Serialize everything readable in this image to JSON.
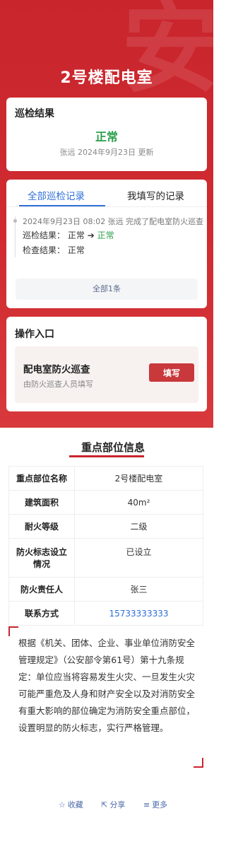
{
  "header": {
    "title": "2号楼配电室"
  },
  "inspection_result": {
    "heading": "巡检结果",
    "status": "正常",
    "meta": "张远 2024年9月23日 更新"
  },
  "records": {
    "tabs": [
      {
        "label": "全部巡检记录"
      },
      {
        "label": "我填写的记录"
      }
    ],
    "items": [
      {
        "header": "2024年9月23日 08:02  张远  完成了配电室防火巡查",
        "line1_label": "巡检结果：",
        "line1_from": "正常",
        "line1_arrow": "➔",
        "line1_to": "正常",
        "line2_label": "检查结果：",
        "line2_value": "正常"
      }
    ],
    "more_label": "全部1条"
  },
  "operations": {
    "heading": "操作入口",
    "item_title": "配电室防火巡查",
    "item_desc": "由防火巡查人员填写",
    "button_label": "填写"
  },
  "key_info": {
    "heading": "重点部位信息",
    "rows": [
      {
        "key": "重点部位名称",
        "value": "2号楼配电室"
      },
      {
        "key": "建筑面积",
        "value": "40m²"
      },
      {
        "key": "耐火等级",
        "value": "二级"
      },
      {
        "key": "防火标志设立情况",
        "value": "已设立"
      },
      {
        "key": "防火责任人",
        "value": "张三"
      },
      {
        "key": "联系方式",
        "value": "15733333333"
      }
    ]
  },
  "regulation_text": "根据《机关、团体、企业、事业单位消防安全管理规定》（公安部令第61号）第十九条规定：单位应当将容易发生火灾、一旦发生火灾可能严重危及人身和财产安全以及对消防安全有重大影响的部位确定为消防安全重点部位，设置明显的防火标志，实行严格管理。",
  "footer": {
    "favorite": "收藏",
    "share": "分享",
    "more": "更多"
  },
  "colors": {
    "brand_red": "#c9252d",
    "ok_green": "#2aa04a",
    "link_blue": "#2f6fd7"
  }
}
